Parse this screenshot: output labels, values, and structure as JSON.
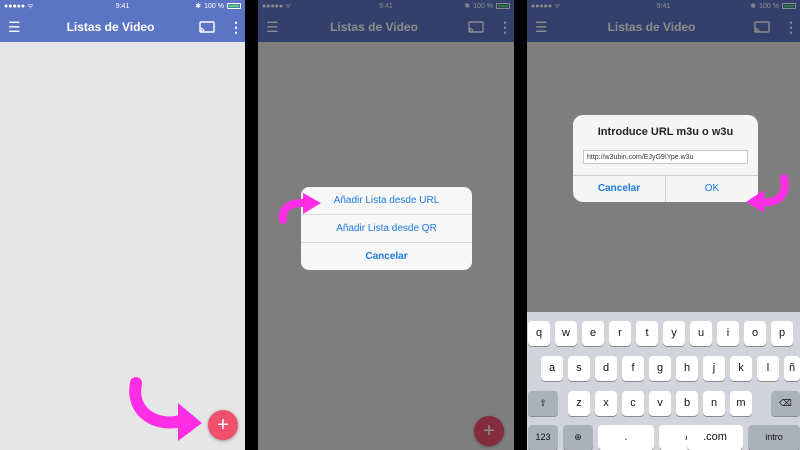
{
  "status": {
    "carrier": "●●●●● ᯤ",
    "time": "9:41",
    "battery_pct": "100 %"
  },
  "appbar": {
    "title": "Listas de Video"
  },
  "fab": {
    "label": "+"
  },
  "sheet": {
    "options": [
      {
        "label": "Añadir Lista desde URL"
      },
      {
        "label": "Añadir Lista desde QR"
      },
      {
        "label": "Cancelar"
      }
    ]
  },
  "dialog": {
    "title": "Introduce URL m3u o w3u",
    "input_value": "http://w3ubin.com/EJyG9IYpe.w3u",
    "cancel_label": "Cancelar",
    "ok_label": "OK"
  },
  "keyboard": {
    "row1": [
      "q",
      "w",
      "e",
      "r",
      "t",
      "y",
      "u",
      "i",
      "o",
      "p"
    ],
    "row2": [
      "a",
      "s",
      "d",
      "f",
      "g",
      "h",
      "j",
      "k",
      "l",
      "ñ"
    ],
    "row3": [
      "z",
      "x",
      "c",
      "v",
      "b",
      "n",
      "m"
    ],
    "numbers_label": "123",
    "dot_label": ".",
    "slash_label": "/",
    "com_label": ".com",
    "return_label": "intro"
  },
  "colors": {
    "appbar": "#5b75c4",
    "appbar_dimmed": "#2f3e66",
    "fab": "#f0506e",
    "accent_arrow": "#ff2ee6",
    "link_blue": "#1a7ae0"
  },
  "icons": [
    "menu-icon",
    "cast-icon",
    "more-icon",
    "plus-icon",
    "globe-icon",
    "shift-icon",
    "backspace-icon",
    "wifi-icon",
    "bluetooth-icon",
    "battery-icon"
  ]
}
